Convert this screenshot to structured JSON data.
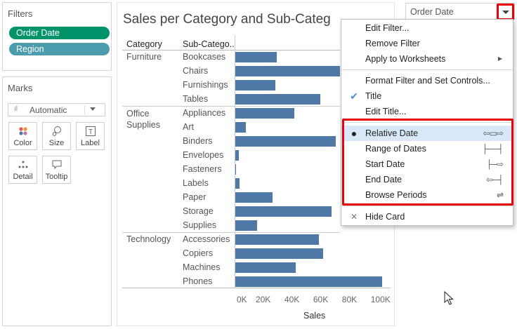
{
  "filters": {
    "title": "Filters",
    "pills": [
      {
        "label": "Order Date",
        "color": "#03936b"
      },
      {
        "label": "Region",
        "color": "#4b9dad"
      }
    ]
  },
  "marks": {
    "title": "Marks",
    "type_label": "Automatic",
    "buttons": {
      "color": "Color",
      "size": "Size",
      "label": "Label",
      "detail": "Detail",
      "tooltip": "Tooltip"
    }
  },
  "sheet": {
    "title": "Sales per Category and Sub-Categ"
  },
  "filter_card": {
    "title": "Order Date"
  },
  "menu": {
    "items": [
      {
        "label": "Edit Filter...",
        "checked": false,
        "glyph": ""
      },
      {
        "label": "Remove Filter",
        "checked": false,
        "glyph": ""
      },
      {
        "label": "Apply to Worksheets",
        "checked": false,
        "glyph": "▶"
      },
      {
        "label": "Format Filter and Set Controls...",
        "checked": false,
        "glyph": ""
      },
      {
        "label": "Title",
        "checked": true,
        "glyph": ""
      },
      {
        "label": "Edit Title...",
        "checked": false,
        "glyph": ""
      },
      {
        "label": "Relative Date",
        "checked": true,
        "glyph": "⇦▭⇨",
        "selected": true
      },
      {
        "label": "Range of Dates",
        "checked": false,
        "glyph": "├──┤"
      },
      {
        "label": "Start Date",
        "checked": false,
        "glyph": "├─⇨"
      },
      {
        "label": "End Date",
        "checked": false,
        "glyph": "⇦─┤"
      },
      {
        "label": "Browse Periods",
        "checked": false,
        "glyph": "⇌"
      },
      {
        "label": "Hide Card",
        "checked": false,
        "glyph": ""
      }
    ]
  },
  "colors": {
    "bar": "#4e79a7",
    "highlight": "#e8000b",
    "menu_hover": "#d8e8f8"
  },
  "chart_data": {
    "type": "bar",
    "orientation": "horizontal",
    "title": "Sales per Category and Sub-Categ",
    "headers": {
      "category": "Category",
      "subcategory": "Sub-Catego.."
    },
    "xlabel": "Sales",
    "xlim": [
      0,
      105000
    ],
    "x_ticks": [
      "0K",
      "20K",
      "40K",
      "60K",
      "80K",
      "100K"
    ],
    "groups": [
      {
        "category": "Furniture",
        "rows": [
          {
            "sub": "Bookcases",
            "value": 29000
          },
          {
            "sub": "Chairs",
            "value": 73000
          },
          {
            "sub": "Furnishings",
            "value": 28000
          },
          {
            "sub": "Tables",
            "value": 59000
          }
        ]
      },
      {
        "category": "Office\nSupplies",
        "rows": [
          {
            "sub": "Appliances",
            "value": 41000
          },
          {
            "sub": "Art",
            "value": 7500
          },
          {
            "sub": "Binders",
            "value": 70000
          },
          {
            "sub": "Envelopes",
            "value": 2500
          },
          {
            "sub": "Fasteners",
            "value": 500
          },
          {
            "sub": "Labels",
            "value": 2800
          },
          {
            "sub": "Paper",
            "value": 26000
          },
          {
            "sub": "Storage",
            "value": 67000
          },
          {
            "sub": "Supplies",
            "value": 15000
          }
        ]
      },
      {
        "category": "Technology",
        "rows": [
          {
            "sub": "Accessories",
            "value": 58000
          },
          {
            "sub": "Copiers",
            "value": 61000
          },
          {
            "sub": "Machines",
            "value": 42000
          },
          {
            "sub": "Phones",
            "value": 102000
          }
        ]
      }
    ]
  }
}
